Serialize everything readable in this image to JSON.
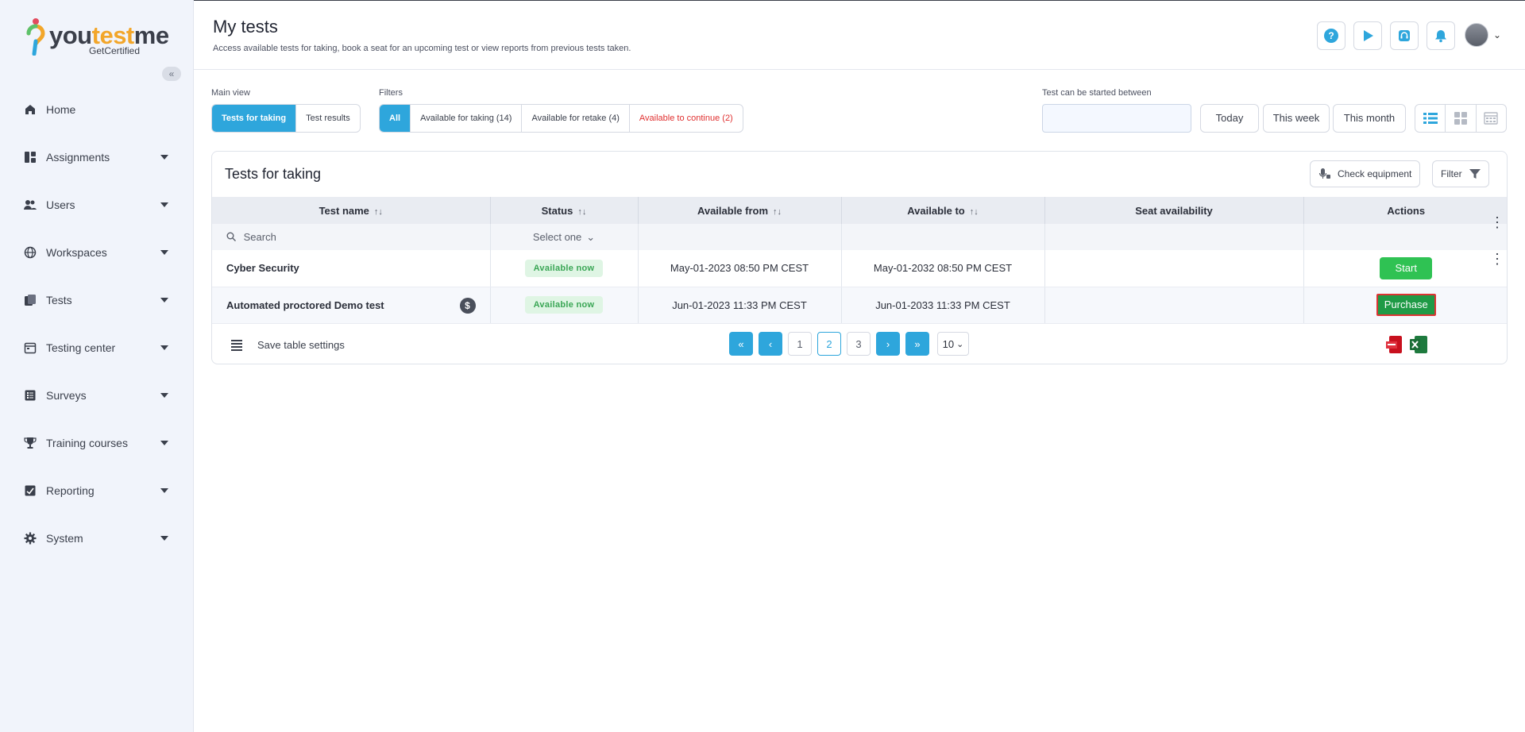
{
  "brand": {
    "logo_you": "you",
    "logo_test": "test",
    "logo_me": "me",
    "tagline": "GetCertified"
  },
  "sidebar": {
    "collapse_glyph": "«",
    "items": [
      {
        "label": "Home",
        "icon": "home-icon",
        "has_caret": false
      },
      {
        "label": "Assignments",
        "icon": "assignments-icon",
        "has_caret": true
      },
      {
        "label": "Users",
        "icon": "users-icon",
        "has_caret": true
      },
      {
        "label": "Workspaces",
        "icon": "globe-icon",
        "has_caret": true
      },
      {
        "label": "Tests",
        "icon": "tests-icon",
        "has_caret": true
      },
      {
        "label": "Testing center",
        "icon": "calendar-icon",
        "has_caret": true
      },
      {
        "label": "Surveys",
        "icon": "surveys-icon",
        "has_caret": true
      },
      {
        "label": "Training courses",
        "icon": "trophy-icon",
        "has_caret": true
      },
      {
        "label": "Reporting",
        "icon": "reporting-icon",
        "has_caret": true
      },
      {
        "label": "System",
        "icon": "gear-icon",
        "has_caret": true
      }
    ]
  },
  "header": {
    "title": "My tests",
    "subtitle": "Access available tests for taking, book a seat for an upcoming test or view reports from previous tests taken.",
    "help_glyph": "?"
  },
  "controls": {
    "main_view_label": "Main view",
    "main_view": [
      "Tests for taking",
      "Test results"
    ],
    "filters_label": "Filters",
    "filters": [
      "All",
      "Available for taking (14)",
      "Available for retake (4)",
      "Available to continue (2)"
    ],
    "date_label": "Test can be started between",
    "quick": [
      "Today",
      "This week",
      "This month"
    ]
  },
  "card": {
    "title": "Tests for taking",
    "check_equipment": "Check equipment",
    "filter": "Filter"
  },
  "table": {
    "columns": [
      "Test name",
      "Status",
      "Available from",
      "Available to",
      "Seat availability",
      "Actions"
    ],
    "sort_glyph": "↑↓",
    "search_placeholder": "Search",
    "status_select": "Select one",
    "rows": [
      {
        "name": "Cyber Security",
        "status": "Available now",
        "from": "May-01-2023 08:50 PM CEST",
        "to": "May-01-2032 08:50 PM CEST",
        "seat": "",
        "action": "Start"
      },
      {
        "name": "Automated proctored Demo test",
        "status": "Available now",
        "from": "Jun-01-2023 11:33 PM CEST",
        "to": "Jun-01-2033 11:33 PM CEST",
        "seat": "",
        "action": "Purchase",
        "price_glyph": "$"
      }
    ]
  },
  "footer": {
    "save_settings": "Save table settings",
    "pages": [
      "1",
      "2",
      "3"
    ],
    "current_page": "2",
    "page_size": "10"
  }
}
